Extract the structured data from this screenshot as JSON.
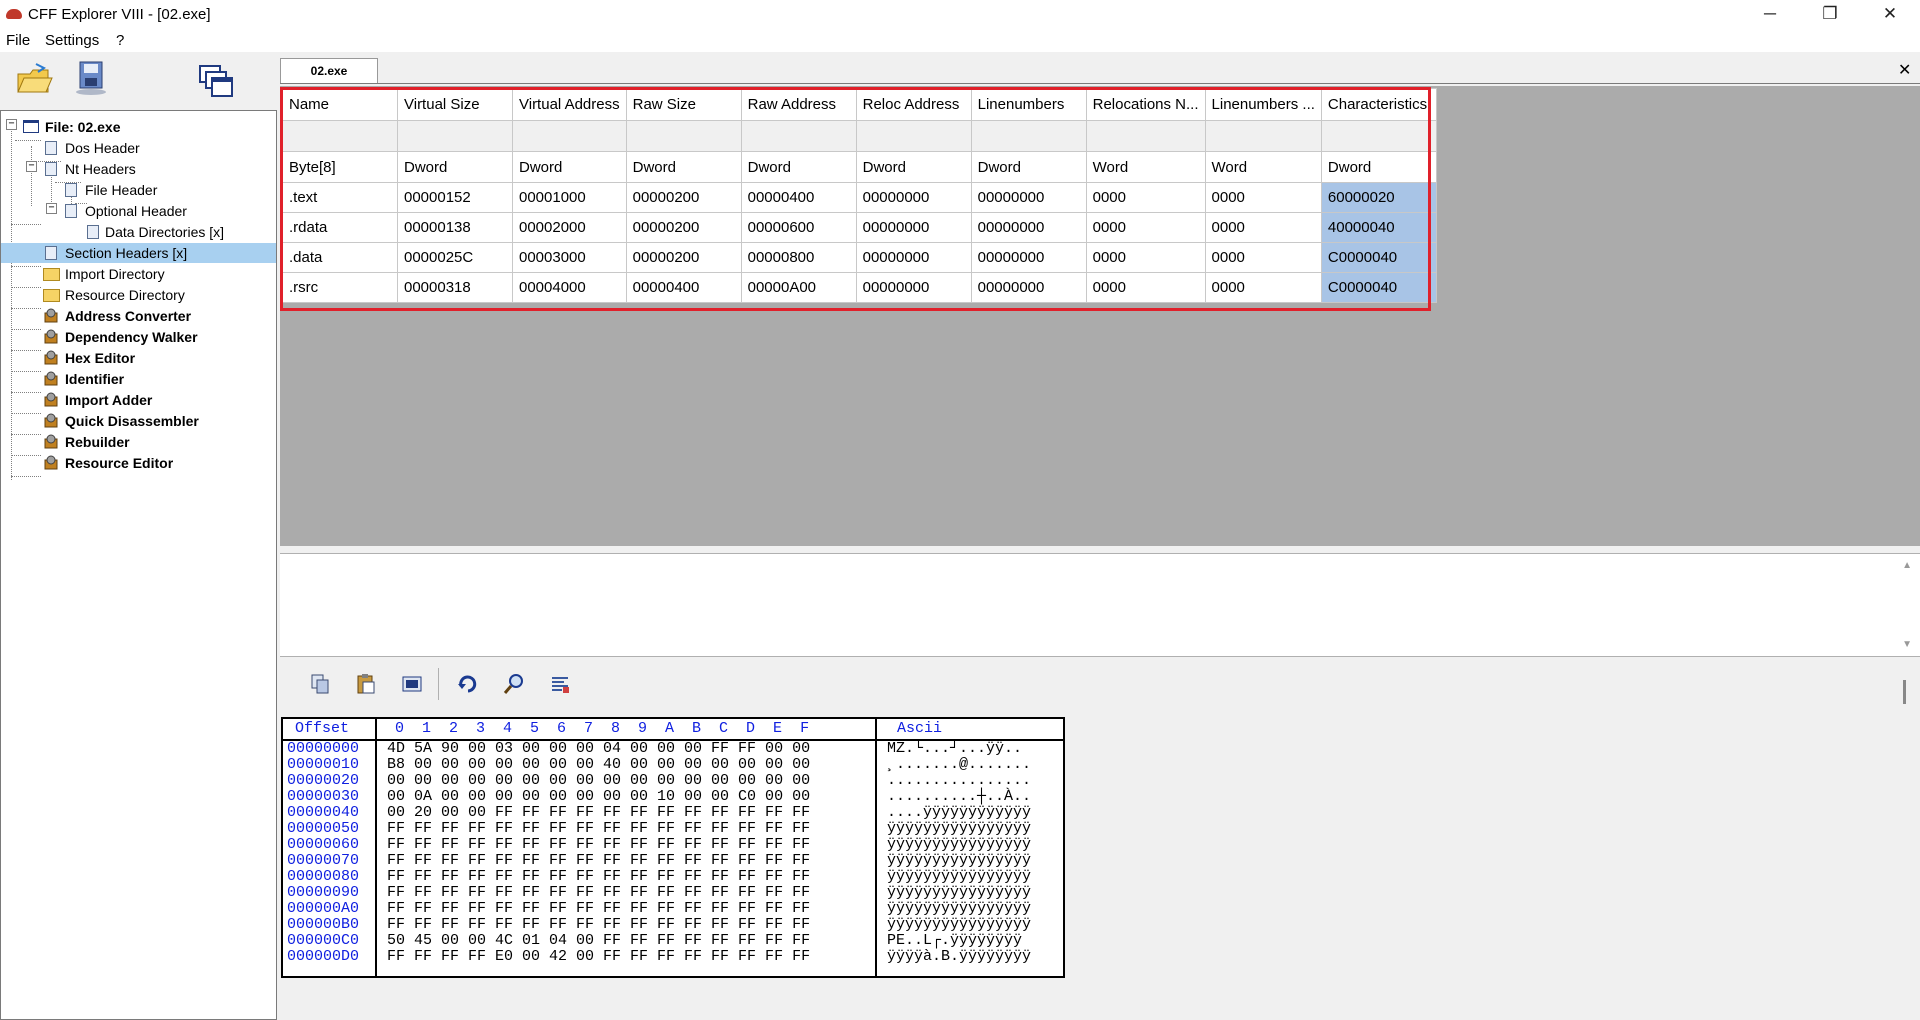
{
  "window": {
    "title": "CFF Explorer VIII - [02.exe]",
    "minimize": "─",
    "restore": "❐",
    "close": "✕"
  },
  "menu": [
    "File",
    "Settings",
    "?"
  ],
  "toolbar_icons": [
    "open-folder-icon",
    "save-disk-icon",
    "windows-icon"
  ],
  "tree": [
    {
      "label": "File: 02.exe",
      "bold": true
    },
    {
      "label": "Dos Header"
    },
    {
      "label": "Nt Headers"
    },
    {
      "label": "File Header"
    },
    {
      "label": "Optional Header"
    },
    {
      "label": "Data Directories [x]"
    },
    {
      "label": "Section Headers [x]",
      "selected": true
    },
    {
      "label": "Import Directory"
    },
    {
      "label": "Resource Directory"
    },
    {
      "label": "Address Converter",
      "bold": true
    },
    {
      "label": "Dependency Walker",
      "bold": true
    },
    {
      "label": "Hex Editor",
      "bold": true
    },
    {
      "label": "Identifier",
      "bold": true
    },
    {
      "label": "Import Adder",
      "bold": true
    },
    {
      "label": "Quick Disassembler",
      "bold": true
    },
    {
      "label": "Rebuilder",
      "bold": true
    },
    {
      "label": "Resource Editor",
      "bold": true
    }
  ],
  "tab": {
    "label": "02.exe",
    "close": "✕"
  },
  "section_table": {
    "headers": [
      "Name",
      "Virtual Size",
      "Virtual Address",
      "Raw Size",
      "Raw Address",
      "Reloc Address",
      "Linenumbers",
      "Relocations N...",
      "Linenumbers ...",
      "Characteristics"
    ],
    "types": [
      "Byte[8]",
      "Dword",
      "Dword",
      "Dword",
      "Dword",
      "Dword",
      "Dword",
      "Word",
      "Word",
      "Dword"
    ],
    "rows": [
      [
        ".text",
        "00000152",
        "00001000",
        "00000200",
        "00000400",
        "00000000",
        "00000000",
        "0000",
        "0000",
        "60000020"
      ],
      [
        ".rdata",
        "00000138",
        "00002000",
        "00000200",
        "00000600",
        "00000000",
        "00000000",
        "0000",
        "0000",
        "40000040"
      ],
      [
        ".data",
        "0000025C",
        "00003000",
        "00000200",
        "00000800",
        "00000000",
        "00000000",
        "0000",
        "0000",
        "C0000040"
      ],
      [
        ".rsrc",
        "00000318",
        "00004000",
        "00000400",
        "00000A00",
        "00000000",
        "00000000",
        "0000",
        "0000",
        "C0000040"
      ]
    ]
  },
  "hex_toolbar": [
    "copy-icon",
    "paste-icon",
    "select-block-icon",
    "goto-icon",
    "search-icon",
    "options-icon"
  ],
  "hex": {
    "offset_label": "Offset",
    "columns": "0  1  2  3  4  5  6  7  8  9  A  B  C  D  E  F",
    "ascii_label": "Ascii",
    "rows": [
      {
        "off": "00000000",
        "bytes": "4D 5A 90 00 03 00 00 00 04 00 00 00 FF FF 00 00",
        "ascii": "MZ.└...┘...ÿÿ.."
      },
      {
        "off": "00000010",
        "bytes": "B8 00 00 00 00 00 00 00 40 00 00 00 00 00 00 00",
        "ascii": "¸.......@......."
      },
      {
        "off": "00000020",
        "bytes": "00 00 00 00 00 00 00 00 00 00 00 00 00 00 00 00",
        "ascii": "................"
      },
      {
        "off": "00000030",
        "bytes": "00 0A 00 00 00 00 00 00 00 00 10 00 00 C0 00 00",
        "ascii": "..........┼..À.."
      },
      {
        "off": "00000040",
        "bytes": "00 20 00 00 FF FF FF FF FF FF FF FF FF FF FF FF",
        "ascii": "....ÿÿÿÿÿÿÿÿÿÿÿÿ"
      },
      {
        "off": "00000050",
        "bytes": "FF FF FF FF FF FF FF FF FF FF FF FF FF FF FF FF",
        "ascii": "ÿÿÿÿÿÿÿÿÿÿÿÿÿÿÿÿ"
      },
      {
        "off": "00000060",
        "bytes": "FF FF FF FF FF FF FF FF FF FF FF FF FF FF FF FF",
        "ascii": "ÿÿÿÿÿÿÿÿÿÿÿÿÿÿÿÿ"
      },
      {
        "off": "00000070",
        "bytes": "FF FF FF FF FF FF FF FF FF FF FF FF FF FF FF FF",
        "ascii": "ÿÿÿÿÿÿÿÿÿÿÿÿÿÿÿÿ"
      },
      {
        "off": "00000080",
        "bytes": "FF FF FF FF FF FF FF FF FF FF FF FF FF FF FF FF",
        "ascii": "ÿÿÿÿÿÿÿÿÿÿÿÿÿÿÿÿ"
      },
      {
        "off": "00000090",
        "bytes": "FF FF FF FF FF FF FF FF FF FF FF FF FF FF FF FF",
        "ascii": "ÿÿÿÿÿÿÿÿÿÿÿÿÿÿÿÿ"
      },
      {
        "off": "000000A0",
        "bytes": "FF FF FF FF FF FF FF FF FF FF FF FF FF FF FF FF",
        "ascii": "ÿÿÿÿÿÿÿÿÿÿÿÿÿÿÿÿ"
      },
      {
        "off": "000000B0",
        "bytes": "FF FF FF FF FF FF FF FF FF FF FF FF FF FF FF FF",
        "ascii": "ÿÿÿÿÿÿÿÿÿÿÿÿÿÿÿÿ"
      },
      {
        "off": "000000C0",
        "bytes": "50 45 00 00 4C 01 04 00 FF FF FF FF FF FF FF FF",
        "ascii": "PE..L┌.ÿÿÿÿÿÿÿÿ"
      },
      {
        "off": "000000D0",
        "bytes": "FF FF FF FF E0 00 42 00 FF FF FF FF FF FF FF FF",
        "ascii": "ÿÿÿÿà.B.ÿÿÿÿÿÿÿÿ"
      }
    ]
  },
  "colors": {
    "highlight_box": "#e0202a",
    "selected_cell": "#a8c4e6",
    "hex_blue": "#1020e0"
  }
}
